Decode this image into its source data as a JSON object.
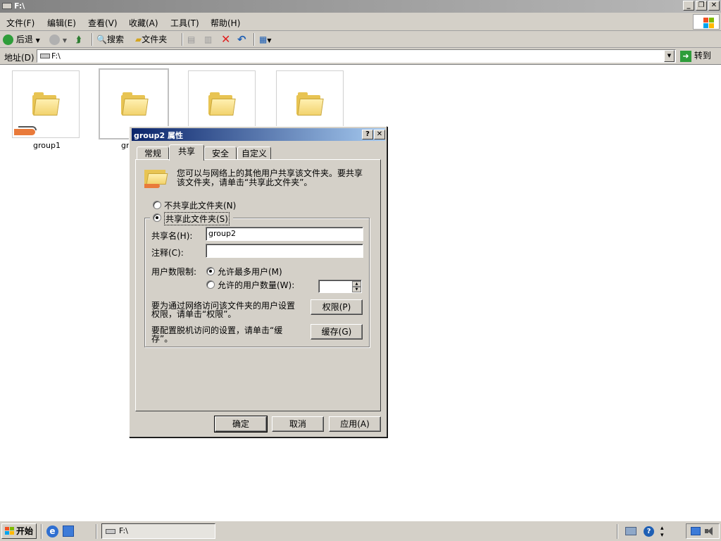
{
  "window": {
    "title": "F:\\",
    "min": "_",
    "max": "❐",
    "close": "✕"
  },
  "menu": [
    "文件(F)",
    "编辑(E)",
    "查看(V)",
    "收藏(A)",
    "工具(T)",
    "帮助(H)"
  ],
  "toolbar": {
    "back": "后退",
    "search": "搜索",
    "folders": "文件夹"
  },
  "address": {
    "label": "地址(D)",
    "value": "F:\\",
    "go": "转到"
  },
  "files": [
    {
      "name": "group1",
      "shared": true
    },
    {
      "name": "gr",
      "shared": false
    },
    {
      "name": "",
      "shared": false
    },
    {
      "name": "",
      "shared": false
    }
  ],
  "dialog": {
    "title": "group2 属性",
    "help": "?",
    "close": "✕",
    "tabs": [
      "常规",
      "共享",
      "安全",
      "自定义"
    ],
    "active_tab": "共享",
    "intro_line1": "您可以与网络上的其他用户共享该文件夹。要共享",
    "intro_line2": "该文件夹，请单击“共享此文件夹”。",
    "no_share": "不共享此文件夹(N)",
    "share": "共享此文件夹(S)",
    "share_name_label": "共享名(H):",
    "share_name_value": "group2",
    "comment_label": "注释(C):",
    "comment_value": "",
    "user_limit_label": "用户数限制:",
    "max_allowed": "允许最多用户(M)",
    "allow_users": "允许的用户数量(W):",
    "permissions_text1": "要为通过网络访问该文件夹的用户设置",
    "permissions_text2": "权限，请单击“权限”。",
    "permissions_btn": "权限(P)",
    "cache_text1": "要配置脱机访问的设置，请单击“缓",
    "cache_text2": "存”。",
    "cache_btn": "缓存(G)",
    "ok": "确定",
    "cancel": "取消",
    "apply": "应用(A)"
  },
  "taskbar": {
    "start": "开始",
    "task": "F:\\"
  }
}
